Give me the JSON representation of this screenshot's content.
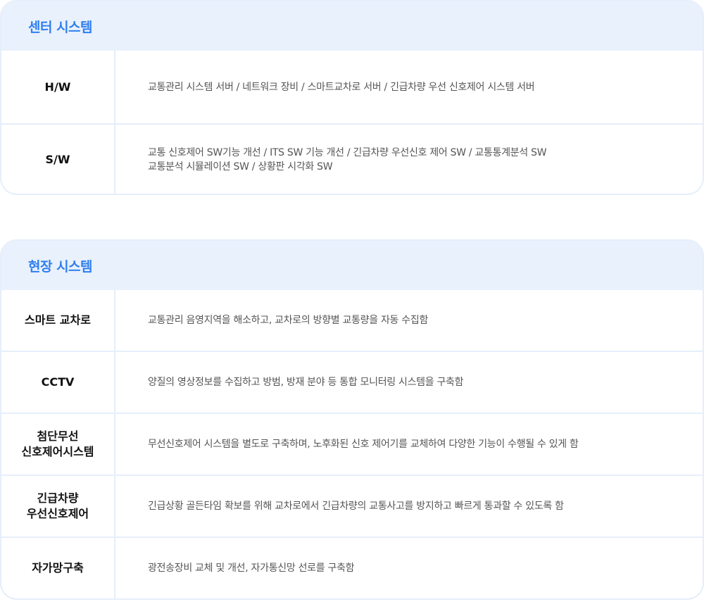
{
  "center": {
    "title": "센터 시스템",
    "rows": [
      {
        "label": "H/W",
        "lines": [
          "교통관리 시스템 서버 / 네트워크 장비 / 스마트교차로 서버 / 긴급차량 우선 신호제어 시스템 서버"
        ]
      },
      {
        "label": "S/W",
        "lines": [
          "교통 신호제어 SW기능 개선 / ITS SW 기능 개선 / 긴급차량 우선신호 제어 SW / 교통통계분석 SW",
          "교통분석 시뮬레이션 SW / 상황판 시각화 SW"
        ]
      }
    ]
  },
  "field": {
    "title": "현장 시스템",
    "rows": [
      {
        "label": "스마트 교차로",
        "desc": "교통관리 음영지역을 해소하고, 교차로의 방향별 교통량을 자동 수집함"
      },
      {
        "label": "CCTV",
        "desc": "양질의 영상정보를 수집하고 방범, 방재 분야 등 통합 모니터링 시스템을 구축함"
      },
      {
        "label": "첨단무선\n신호제어시스템",
        "desc": "무선신호제어 시스템을 별도로 구축하며, 노후화된 신호 제어기를 교체하여 다양한 기능이 수행될 수 있게 함"
      },
      {
        "label": "긴급차량\n우선신호제어",
        "desc": "긴급상황 골든타임 확보를 위해 교차로에서 긴급차량의 교통사고를 방지하고 빠르게 통과할 수 있도록 함"
      },
      {
        "label": "자가망구축",
        "desc": "광전송장비 교체 및 개선, 자가통신망 선로를 구축함"
      }
    ]
  }
}
